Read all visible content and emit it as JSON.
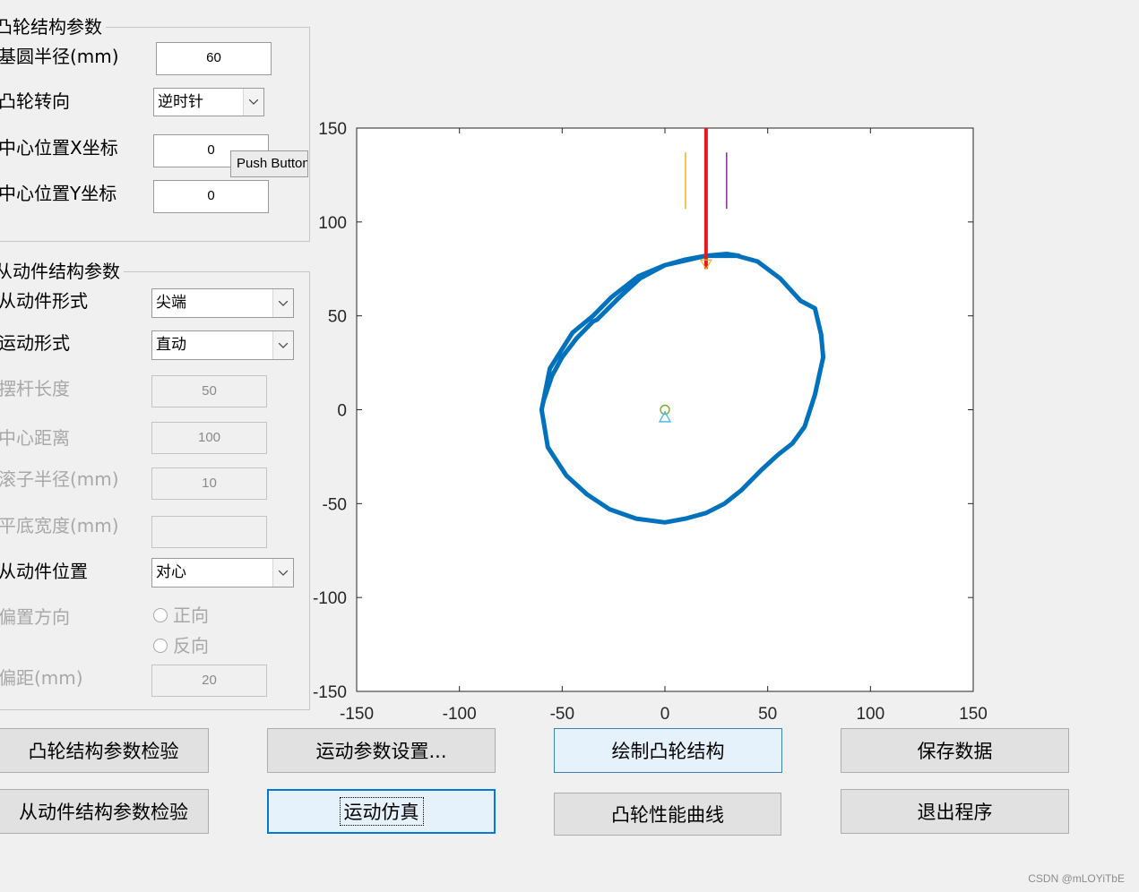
{
  "cam_group": {
    "title": "凸轮结构参数",
    "base_radius_label": "基圆半径(mm)",
    "base_radius_value": "60",
    "rotation_label": "凸轮转向",
    "rotation_value": "逆时针",
    "center_x_label": "中心位置X坐标",
    "center_x_value": "0",
    "center_y_label": "中心位置Y坐标",
    "center_y_value": "0",
    "tooltip": "Push Button"
  },
  "follower_group": {
    "title": "从动件结构参数",
    "type_label": "从动件形式",
    "type_value": "尖端",
    "motion_label": "运动形式",
    "motion_value": "直动",
    "rocker_length_label": "摆杆长度",
    "rocker_length_value": "50",
    "center_distance_label": "中心距离",
    "center_distance_value": "100",
    "roller_radius_label": "滚子半径(mm)",
    "roller_radius_value": "10",
    "flat_width_label": "平底宽度(mm)",
    "flat_width_value": "",
    "position_label": "从动件位置",
    "position_value": "对心",
    "offset_dir_label": "偏置方向",
    "offset_dir_positive": "正向",
    "offset_dir_negative": "反向",
    "offset_label": "偏距(mm)",
    "offset_value": "20"
  },
  "buttons": {
    "check_cam": "凸轮结构参数检验",
    "check_follower": "从动件结构参数检验",
    "motion_settings": "运动参数设置...",
    "simulate": "运动仿真",
    "draw_cam": "绘制凸轮结构",
    "performance_curves": "凸轮性能曲线",
    "save_data": "保存数据",
    "exit": "退出程序"
  },
  "watermark": "CSDN @mLOYiTbE",
  "colors": {
    "cam_profile": "#0072bd",
    "follower": "#e41a1c",
    "marker_green": "#77ac30",
    "marker_cyan": "#4dbeee",
    "line_yellow": "#edb120",
    "line_purple": "#7e2f8e"
  },
  "chart_data": {
    "type": "line",
    "xlim": [
      -150,
      150
    ],
    "ylim": [
      -150,
      150
    ],
    "x_ticks": [
      -150,
      -100,
      -50,
      0,
      50,
      100,
      150
    ],
    "y_ticks": [
      150,
      100,
      50,
      0,
      -50,
      -100,
      -150
    ],
    "grid": false,
    "series": [
      {
        "x": [
          -60,
          -56,
          -45,
          -35,
          -26,
          -13,
          0,
          20,
          35,
          45,
          56,
          66,
          73,
          76,
          77,
          73,
          68,
          62,
          55,
          47,
          37,
          29,
          20,
          10,
          0,
          -14,
          -27,
          -38,
          -48,
          -57,
          -60,
          -59,
          -55,
          -50,
          -43,
          -35,
          -33,
          -22,
          -12,
          0,
          10,
          20,
          30,
          36
        ],
        "y": [
          0,
          22,
          41,
          50,
          60,
          71,
          77,
          82,
          82,
          79,
          70,
          58,
          54,
          40,
          28,
          8,
          -9,
          -18,
          -24,
          -32,
          -43,
          -50,
          -55,
          -58,
          -60,
          -58,
          -53,
          -45,
          -35,
          -20,
          0,
          5,
          18,
          28,
          38,
          47,
          48,
          60,
          70,
          77,
          80,
          82,
          83,
          82
        ]
      }
    ],
    "follower_line": {
      "x": [
        20,
        20
      ],
      "y": [
        150,
        75
      ]
    },
    "vertical_marks": [
      {
        "x": 10,
        "y": [
          107,
          137
        ]
      },
      {
        "x": 30,
        "y": [
          107,
          137
        ]
      }
    ],
    "center_markers": [
      {
        "shape": "circle",
        "x": 0,
        "y": 0
      },
      {
        "shape": "triangle",
        "x": 0,
        "y": -4
      }
    ]
  }
}
